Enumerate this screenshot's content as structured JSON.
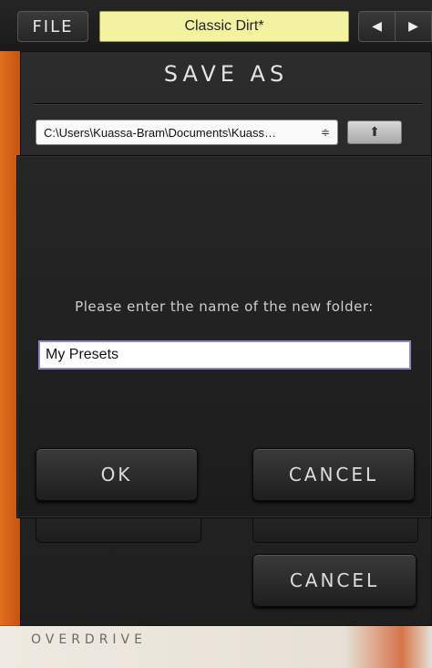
{
  "header": {
    "file_label": "FILE",
    "preset_name": "Classic Dirt*",
    "prev_icon": "triangle-left-icon",
    "next_icon": "triangle-right-icon"
  },
  "save_as": {
    "title": "SAVE AS",
    "path": "C:\\Users\\Kuassa-Bram\\Documents\\Kuass…",
    "path_arrows": "≑",
    "up_icon": "up-arrow-icon",
    "cancel_label": "CANCEL"
  },
  "new_folder": {
    "prompt": "Please enter the name of the new folder:",
    "input_value": "My Presets",
    "ok_label": "OK",
    "cancel_label": "CANCEL"
  },
  "plugin": {
    "brand": "OVERDRIVE"
  }
}
